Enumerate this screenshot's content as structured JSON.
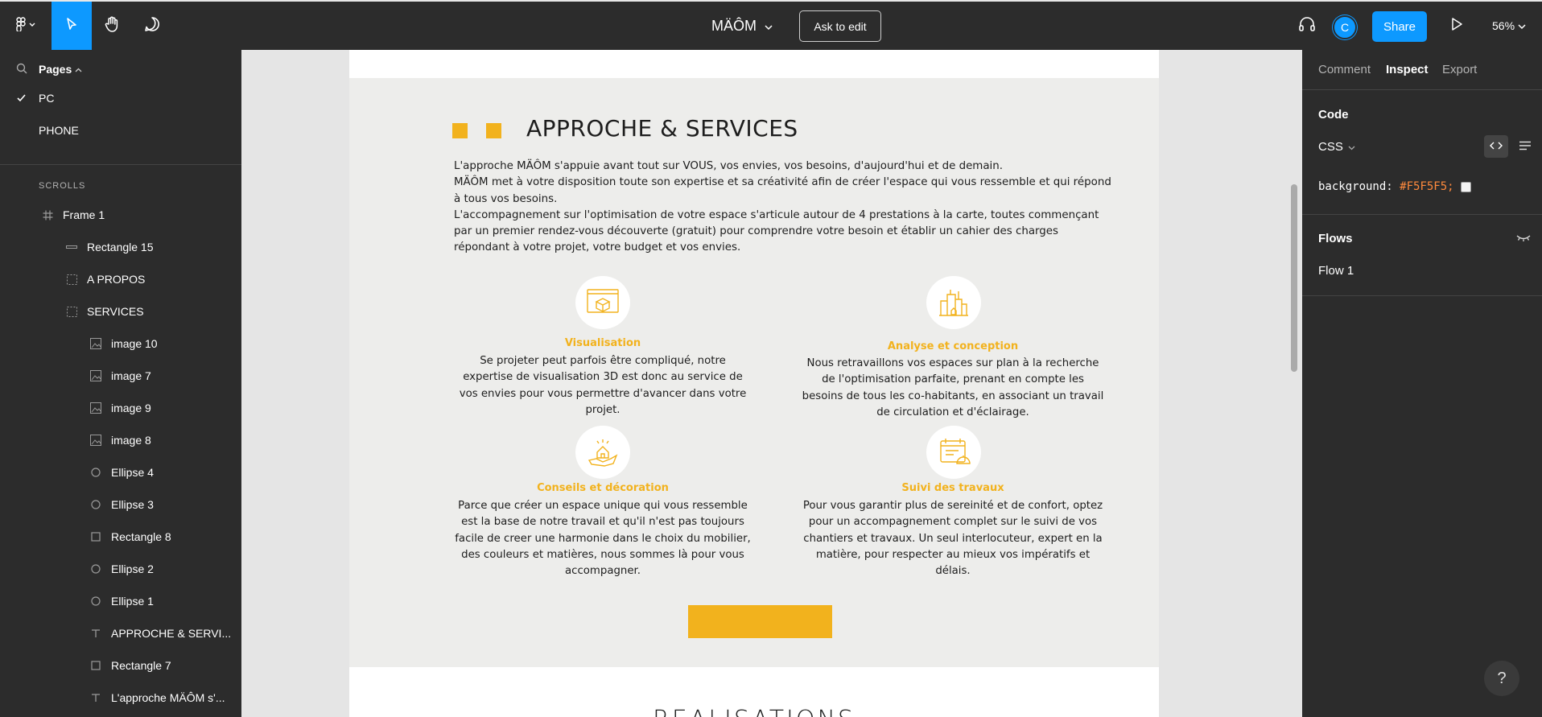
{
  "toolbar": {
    "file_title": "MÄÔM",
    "ask_to_edit": "Ask to edit",
    "avatar_initial": "C",
    "share": "Share",
    "zoom": "56%"
  },
  "left_panel": {
    "pages_label": "Pages",
    "pages": [
      {
        "label": "PC",
        "selected": true
      },
      {
        "label": "PHONE",
        "selected": false
      }
    ],
    "layers_section": "SCROLLS",
    "layers": [
      {
        "label": "Frame 1",
        "icon": "frame-icon"
      },
      {
        "label": "Rectangle 15",
        "icon": "line-icon"
      },
      {
        "label": "A PROPOS",
        "icon": "section-icon"
      },
      {
        "label": "SERVICES",
        "icon": "section-icon"
      },
      {
        "label": "image 10",
        "icon": "image-icon"
      },
      {
        "label": "image 7",
        "icon": "image-icon"
      },
      {
        "label": "image 9",
        "icon": "image-icon"
      },
      {
        "label": "image 8",
        "icon": "image-icon"
      },
      {
        "label": "Ellipse 4",
        "icon": "ellipse-icon"
      },
      {
        "label": "Ellipse 3",
        "icon": "ellipse-icon"
      },
      {
        "label": "Rectangle 8",
        "icon": "rectangle-icon"
      },
      {
        "label": "Ellipse 2",
        "icon": "ellipse-icon"
      },
      {
        "label": "Ellipse 1",
        "icon": "ellipse-icon"
      },
      {
        "label": "APPROCHE & SERVI...",
        "icon": "text-icon"
      },
      {
        "label": "Rectangle 7",
        "icon": "rectangle-icon"
      },
      {
        "label": "L'approche MÄÔM s'...",
        "icon": "text-icon"
      }
    ]
  },
  "canvas": {
    "section_title": "APPROCHE & SERVICES",
    "intro": [
      "L'approche MÄÔM s'appuie avant tout sur VOUS, vos envies, vos besoins, d'aujourd'hui et de demain.",
      "MÄÔM met à votre disposition toute son expertise et sa créativité afin de créer l'espace qui vous ressemble et qui répond à tous vos besoins.",
      "L'accompagnement sur l'optimisation de votre espace s'articule autour de 4 prestations à la carte, toutes commençant par un premier rendez-vous découverte (gratuit) pour comprendre votre besoin et établir un cahier des charges répondant à votre projet, votre budget et vos envies."
    ],
    "services": [
      {
        "title": "Visualisation",
        "text": "Se projeter peut parfois être compliqué, notre expertise de visualisation 3D est donc au service de vos envies pour vous permettre d'avancer dans votre projet."
      },
      {
        "title": "Analyse et conception",
        "text": "Nous retravaillons vos espaces sur plan à la recherche de l'optimisation parfaite, prenant en compte les besoins de tous les co-habitants, en associant un travail de circulation et d'éclairage."
      },
      {
        "title": "Conseils et décoration",
        "text": "Parce que créer un espace unique qui vous ressemble est la base de notre travail et qu'il n'est pas toujours facile de creer une harmonie dans le choix du mobilier, des couleurs et matières, nous sommes là pour vous accompagner."
      },
      {
        "title": "Suivi des travaux",
        "text": "Pour vous garantir plus de sereinité et de confort, optez pour un accompagnement complet sur le suivi de vos chantiers et travaux. Un seul interlocuteur, expert en la matière, pour respecter au mieux vos impératifs et délais."
      }
    ],
    "next_section_title": "REALISATIONS",
    "accent_color": "#f2b21d"
  },
  "right_panel": {
    "tabs": [
      "Comment",
      "Inspect",
      "Export"
    ],
    "active_tab": "Inspect",
    "code_title": "Code",
    "language": "CSS",
    "css_property": "background:",
    "css_value": "#F5F5F5;",
    "flows_title": "Flows",
    "flow_item": "Flow 1",
    "help": "?"
  }
}
